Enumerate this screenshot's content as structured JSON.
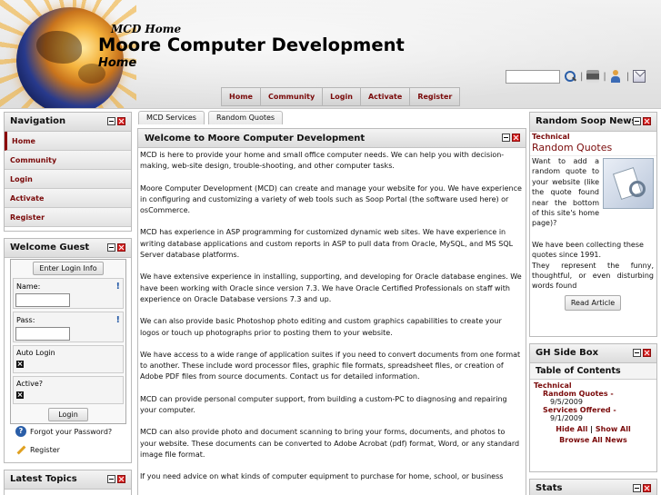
{
  "header": {
    "small_title": "MCD Home",
    "title": "Moore Computer Development",
    "subtitle": "Home",
    "search_value": ""
  },
  "main_menu": [
    "Home",
    "Community",
    "Login",
    "Activate",
    "Register"
  ],
  "navigation": {
    "title": "Navigation",
    "items": [
      "Home",
      "Community",
      "Login",
      "Activate",
      "Register"
    ]
  },
  "welcome": {
    "title": "Welcome Guest",
    "login_info_button": "Enter Login Info",
    "name_label": "Name:",
    "pass_label": "Pass:",
    "auto_login_label": "Auto Login",
    "active_label": "Active?",
    "login_button": "Login",
    "forgot_password": "Forgot your Password?",
    "register": "Register"
  },
  "latest_topics": {
    "title": "Latest Topics"
  },
  "tabs": [
    "MCD Services",
    "Random Quotes"
  ],
  "content": {
    "title": "Welcome to Moore Computer Development",
    "paragraphs": [
      "MCD is here to provide your home and small office computer needs.  We can help you with decision-making, web-site design, trouble-shooting, and other computer tasks.",
      "Moore Computer Development (MCD) can create and manage your website for you.  We have experience in configuring and customizing a variety of web tools such as Soop Portal (the software used here) or osCommerce.",
      "MCD has experience in ASP programming for customized dynamic web sites. We have experience in writing database applications and custom reports in ASP to pull data from Oracle, MySQL, and MS SQL Server database platforms.",
      "We have extensive experience in installing, supporting, and developing for Oracle database engines.  We have been working with Oracle since version 7.3.  We have Oracle Certified Professionals on staff with experience on Oracle Database versions 7.3 and up.",
      "We can also provide basic Photoshop photo editing and custom graphics capabilities to create your logos or touch up photographs prior to posting them to your website.",
      "We have access to a wide range of application suites if you need to convert documents from one format to another. These include word processor files, graphic file formats, spreadsheet files, or creation of Adobe PDF files from source documents.  Contact us for detailed information.",
      "MCD can provide personal computer support, from building a custom-PC to diagnosing and repairing your computer.",
      "MCD can also provide photo and document scanning to bring your forms, documents, and photos to your website. These documents can be converted to Adobe Acrobat (pdf) format, Word, or any standard image file format.",
      "If you need advice on what kinds of computer equipment to purchase for home, school, or business"
    ]
  },
  "random_soop": {
    "title": "Random Soop News",
    "category": "Technical",
    "headline": "Random Quotes",
    "text1": "Want to add a random quote to your website (like the quote found near the bottom of this site's home page)?",
    "text2": "We have been collecting these quotes since 1991.",
    "text3": "They represent the funny, thoughtful, or even disturbing words found",
    "read_more": "Read Article"
  },
  "gh_side_box": {
    "title": "GH Side Box",
    "toc_title": "Table of Contents",
    "category": "Technical",
    "entries": [
      {
        "title": "Random Quotes -",
        "date": "9/5/2009"
      },
      {
        "title": "Services Offered -",
        "date": "9/1/2009"
      }
    ],
    "hide_all": "Hide All",
    "separator": "|",
    "show_all": "Show All",
    "browse_all": "Browse All News"
  },
  "stats": {
    "title": "Stats"
  },
  "icons": [
    "search-icon",
    "print-icon",
    "users-icon",
    "mail-icon",
    "minimize-icon",
    "close-icon",
    "help-icon",
    "pencil-icon",
    "quote-image"
  ]
}
